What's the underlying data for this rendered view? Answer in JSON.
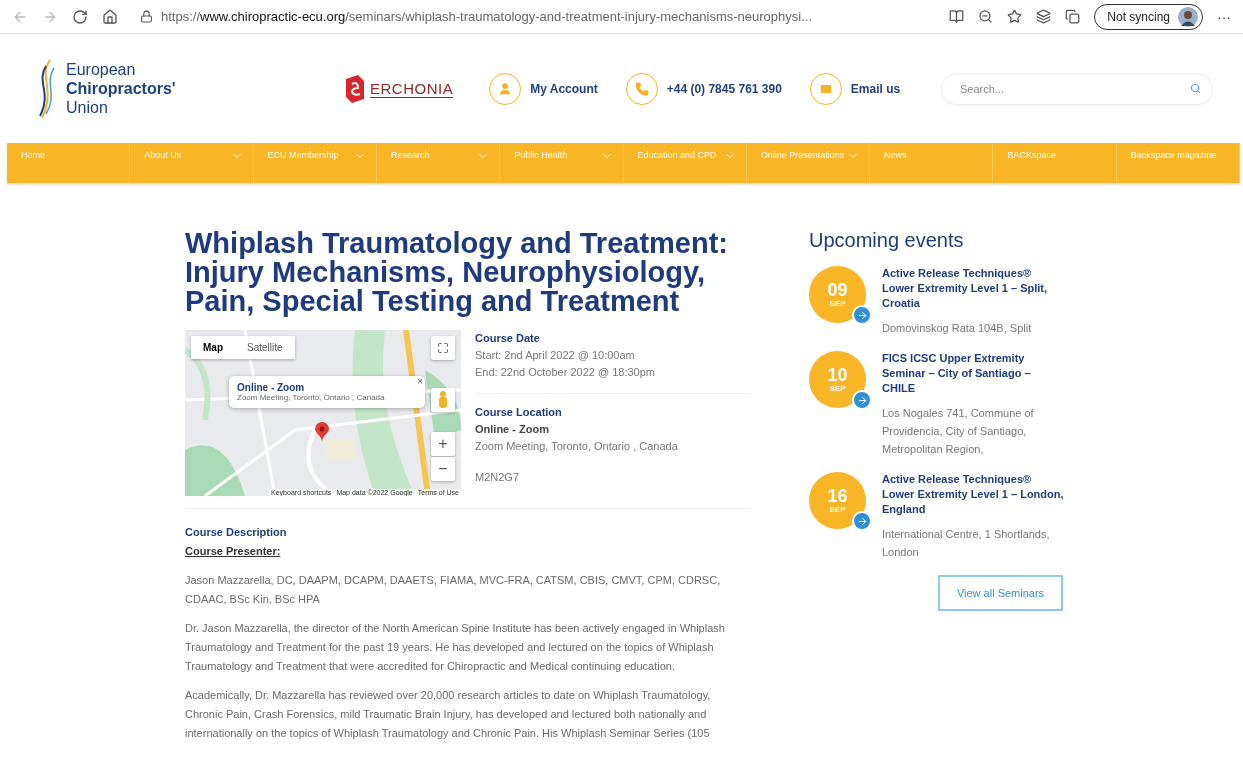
{
  "browser": {
    "url": "https://**www.chiropractic-ecu.org**/seminars/whiplash-traumatology-and-treatment-injury-mechanisms-neurophysi...",
    "sync_label": "Not syncing",
    "more": "···"
  },
  "header": {
    "logo_lines": [
      "European",
      "Chiropractors'",
      "Union"
    ],
    "sponsor": "ERCHONIA",
    "contacts": [
      {
        "kind": "account",
        "label": "My Account"
      },
      {
        "kind": "phone",
        "label": "+44 (0) 7845 761 390"
      },
      {
        "kind": "email",
        "label": "Email us"
      }
    ],
    "search": {
      "placeholder": "Search..."
    }
  },
  "nav": [
    {
      "label": "Home",
      "dropdown": false
    },
    {
      "label": "About Us",
      "dropdown": true
    },
    {
      "label": "ECU Membership",
      "dropdown": true
    },
    {
      "label": "Research",
      "dropdown": true
    },
    {
      "label": "Public Health",
      "dropdown": true
    },
    {
      "label": "Education and CPD",
      "dropdown": true
    },
    {
      "label": "Online Presentations",
      "dropdown": true
    },
    {
      "label": "News",
      "dropdown": false
    },
    {
      "label": "BACKspace",
      "dropdown": false
    },
    {
      "label": "Backspace magazine",
      "dropdown": false
    }
  ],
  "article": {
    "title": "Whiplash Traumatology and Treatment: Injury Mechanisms, Neurophysiology, Pain, Special Testing and Treatment",
    "map": {
      "tabs": [
        {
          "label": "Map",
          "selected": true
        },
        {
          "label": "Satellite",
          "selected": false
        }
      ],
      "popup_title": "Online - Zoom",
      "popup_address": "Zoom Meeting, Toronto, Ontario , Canada",
      "popup_close": "×",
      "zoom_in": "+",
      "zoom_out": "−",
      "attribution": [
        "Keyboard shortcuts",
        "Map data ©2022 Google",
        "Terms of Use"
      ]
    },
    "date_heading": "Course Date",
    "start": "Start: 2nd April 2022 @ 10:00am",
    "end": "End: 22nd October 2022 @ 18:30pm",
    "location_heading": "Course Location",
    "location_name": "Online - Zoom",
    "location_address": "Zoom Meeting, Toronto, Ontario , Canada",
    "postcode": "M2N2G7",
    "description_heading": "Course Description",
    "presenter_heading": "Course Presenter:",
    "paragraphs": [
      "Jason Mazzarella, DC, DAAPM, DCAPM, DAAETS, FIAMA, MVC-FRA, CATSM, CBIS, CMVT, CPM, CDRSC, CDAAC, BSc Kin, BSc HPA",
      "Dr. Jason Mazzarella, the director of the North American Spine Institute has been actively engaged in Whiplash Traumatology and Treatment for the past 19 years. He has developed and lectured on the topics of Whiplash Traumatology and Treatment that were accredited for Chiropractic and Medical continuing education.",
      "Academically, Dr. Mazzarella has reviewed over 20,000 research articles to date on Whiplash Traumatology, Chronic Pain, Crash Forensics, mild Traumatic Brain Injury, has developed and lectured both nationally and internationally on the topics of Whiplash Traumatology and Chronic Pain. His Whiplash Seminar Series (105"
    ]
  },
  "sidebar": {
    "heading": "Upcoming events",
    "events": [
      {
        "day": "09",
        "month": "SEP",
        "title": "Active Release Techniques® Lower Extremity Level 1 – Split, Croatia",
        "address": "Domovinskog Rata 104B, Split"
      },
      {
        "day": "10",
        "month": "SEP",
        "title": "FICS ICSC Upper Extremity Seminar – City of Santiago – CHILE",
        "address": "Los Nogales 741, Commune of Providencia, City of Santiago, Metropolitan Region,"
      },
      {
        "day": "16",
        "month": "SEP",
        "title": "Active Release Techniques® Lower Extremity Level 1 – London, England",
        "address": "International Centre, 1 Shortlands, London"
      }
    ],
    "button": "View all Seminars"
  }
}
